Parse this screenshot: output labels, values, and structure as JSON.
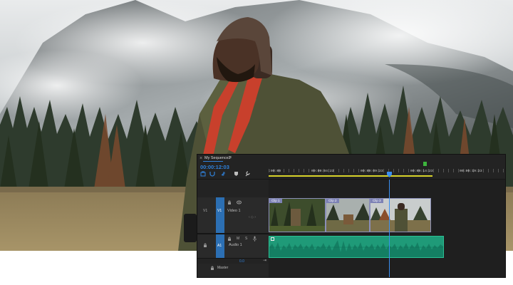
{
  "editor": {
    "sequence_tab": "My Sequence2",
    "timecode": "00:00:12:03",
    "ruler_ticks": [
      ":00:00",
      "00:00:04:23",
      "00:00:09:23",
      "00:00:14:23",
      "00:00:19:23"
    ],
    "video_track": {
      "target": "V1",
      "id": "V1",
      "name": "Video 1"
    },
    "audio_track": {
      "target": "A1",
      "name": "Audio 1",
      "mute": "M",
      "solo": "S"
    },
    "master": {
      "label": "Master",
      "value": "0.0"
    },
    "clips": [
      {
        "label": "Clip 1"
      },
      {
        "label": "Clip 2"
      },
      {
        "label": "Clip 3"
      }
    ]
  },
  "colors": {
    "panel": "#232323",
    "accent_blue": "#2f82dc",
    "clip_label": "#7d82b5",
    "audio_green": "#1f9a78",
    "work_area": "#d8d22a"
  },
  "icons": [
    "mountain-photo",
    "hiker-photo",
    "snap-icon",
    "link-icon",
    "marker-icon",
    "wrench-icon",
    "lock-icon",
    "eye-icon",
    "mic-icon",
    "playhead"
  ]
}
